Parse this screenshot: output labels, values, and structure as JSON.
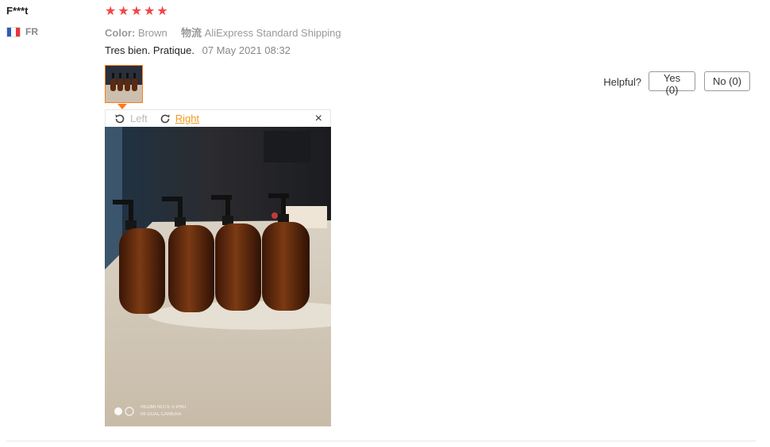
{
  "review": {
    "user": "F***t",
    "country": "FR",
    "rating": 5,
    "color_label": "Color:",
    "color_value": "Brown",
    "shipping_label": "物流",
    "shipping_value": "AliExpress Standard Shipping",
    "text": "Tres bien. Pratique.",
    "date": "07 May 2021 08:32"
  },
  "viewer": {
    "rotate_left": "Left",
    "rotate_right": "Right",
    "close": "×",
    "watermark": [
      "REDMI NOTE 5 PRO",
      "MI DUAL CAMERA"
    ]
  },
  "helpful": {
    "label": "Helpful?",
    "yes": "Yes (0)",
    "no": "No (0)"
  },
  "colors": {
    "star": "#f0474b",
    "accent": "#ff7a1a",
    "link": "#f19a1e"
  },
  "icons": [
    "france-flag-icon",
    "star-icon",
    "rotate-left-icon",
    "rotate-right-icon",
    "close-icon"
  ]
}
